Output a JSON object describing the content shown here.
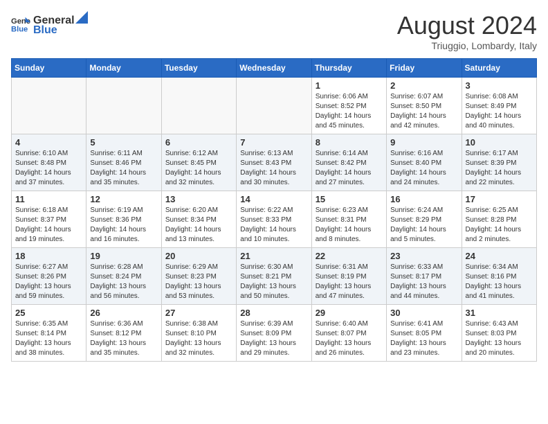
{
  "header": {
    "logo_general": "General",
    "logo_blue": "Blue",
    "month_year": "August 2024",
    "location": "Triuggio, Lombardy, Italy"
  },
  "days_of_week": [
    "Sunday",
    "Monday",
    "Tuesday",
    "Wednesday",
    "Thursday",
    "Friday",
    "Saturday"
  ],
  "weeks": [
    [
      {
        "day": "",
        "info": ""
      },
      {
        "day": "",
        "info": ""
      },
      {
        "day": "",
        "info": ""
      },
      {
        "day": "",
        "info": ""
      },
      {
        "day": "1",
        "info": "Sunrise: 6:06 AM\nSunset: 8:52 PM\nDaylight: 14 hours\nand 45 minutes."
      },
      {
        "day": "2",
        "info": "Sunrise: 6:07 AM\nSunset: 8:50 PM\nDaylight: 14 hours\nand 42 minutes."
      },
      {
        "day": "3",
        "info": "Sunrise: 6:08 AM\nSunset: 8:49 PM\nDaylight: 14 hours\nand 40 minutes."
      }
    ],
    [
      {
        "day": "4",
        "info": "Sunrise: 6:10 AM\nSunset: 8:48 PM\nDaylight: 14 hours\nand 37 minutes."
      },
      {
        "day": "5",
        "info": "Sunrise: 6:11 AM\nSunset: 8:46 PM\nDaylight: 14 hours\nand 35 minutes."
      },
      {
        "day": "6",
        "info": "Sunrise: 6:12 AM\nSunset: 8:45 PM\nDaylight: 14 hours\nand 32 minutes."
      },
      {
        "day": "7",
        "info": "Sunrise: 6:13 AM\nSunset: 8:43 PM\nDaylight: 14 hours\nand 30 minutes."
      },
      {
        "day": "8",
        "info": "Sunrise: 6:14 AM\nSunset: 8:42 PM\nDaylight: 14 hours\nand 27 minutes."
      },
      {
        "day": "9",
        "info": "Sunrise: 6:16 AM\nSunset: 8:40 PM\nDaylight: 14 hours\nand 24 minutes."
      },
      {
        "day": "10",
        "info": "Sunrise: 6:17 AM\nSunset: 8:39 PM\nDaylight: 14 hours\nand 22 minutes."
      }
    ],
    [
      {
        "day": "11",
        "info": "Sunrise: 6:18 AM\nSunset: 8:37 PM\nDaylight: 14 hours\nand 19 minutes."
      },
      {
        "day": "12",
        "info": "Sunrise: 6:19 AM\nSunset: 8:36 PM\nDaylight: 14 hours\nand 16 minutes."
      },
      {
        "day": "13",
        "info": "Sunrise: 6:20 AM\nSunset: 8:34 PM\nDaylight: 14 hours\nand 13 minutes."
      },
      {
        "day": "14",
        "info": "Sunrise: 6:22 AM\nSunset: 8:33 PM\nDaylight: 14 hours\nand 10 minutes."
      },
      {
        "day": "15",
        "info": "Sunrise: 6:23 AM\nSunset: 8:31 PM\nDaylight: 14 hours\nand 8 minutes."
      },
      {
        "day": "16",
        "info": "Sunrise: 6:24 AM\nSunset: 8:29 PM\nDaylight: 14 hours\nand 5 minutes."
      },
      {
        "day": "17",
        "info": "Sunrise: 6:25 AM\nSunset: 8:28 PM\nDaylight: 14 hours\nand 2 minutes."
      }
    ],
    [
      {
        "day": "18",
        "info": "Sunrise: 6:27 AM\nSunset: 8:26 PM\nDaylight: 13 hours\nand 59 minutes."
      },
      {
        "day": "19",
        "info": "Sunrise: 6:28 AM\nSunset: 8:24 PM\nDaylight: 13 hours\nand 56 minutes."
      },
      {
        "day": "20",
        "info": "Sunrise: 6:29 AM\nSunset: 8:23 PM\nDaylight: 13 hours\nand 53 minutes."
      },
      {
        "day": "21",
        "info": "Sunrise: 6:30 AM\nSunset: 8:21 PM\nDaylight: 13 hours\nand 50 minutes."
      },
      {
        "day": "22",
        "info": "Sunrise: 6:31 AM\nSunset: 8:19 PM\nDaylight: 13 hours\nand 47 minutes."
      },
      {
        "day": "23",
        "info": "Sunrise: 6:33 AM\nSunset: 8:17 PM\nDaylight: 13 hours\nand 44 minutes."
      },
      {
        "day": "24",
        "info": "Sunrise: 6:34 AM\nSunset: 8:16 PM\nDaylight: 13 hours\nand 41 minutes."
      }
    ],
    [
      {
        "day": "25",
        "info": "Sunrise: 6:35 AM\nSunset: 8:14 PM\nDaylight: 13 hours\nand 38 minutes."
      },
      {
        "day": "26",
        "info": "Sunrise: 6:36 AM\nSunset: 8:12 PM\nDaylight: 13 hours\nand 35 minutes."
      },
      {
        "day": "27",
        "info": "Sunrise: 6:38 AM\nSunset: 8:10 PM\nDaylight: 13 hours\nand 32 minutes."
      },
      {
        "day": "28",
        "info": "Sunrise: 6:39 AM\nSunset: 8:09 PM\nDaylight: 13 hours\nand 29 minutes."
      },
      {
        "day": "29",
        "info": "Sunrise: 6:40 AM\nSunset: 8:07 PM\nDaylight: 13 hours\nand 26 minutes."
      },
      {
        "day": "30",
        "info": "Sunrise: 6:41 AM\nSunset: 8:05 PM\nDaylight: 13 hours\nand 23 minutes."
      },
      {
        "day": "31",
        "info": "Sunrise: 6:43 AM\nSunset: 8:03 PM\nDaylight: 13 hours\nand 20 minutes."
      }
    ]
  ]
}
